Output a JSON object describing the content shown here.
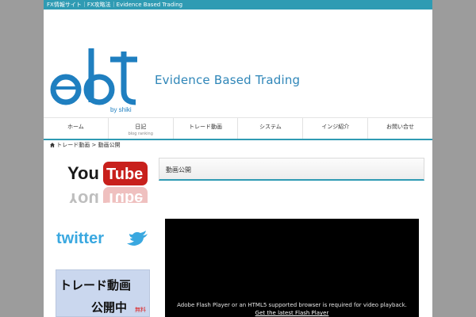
{
  "topbar": {
    "text": "FX情報サイト｜FX攻略法｜Evidence Based Trading"
  },
  "header": {
    "logo_letters": "ebt",
    "logo_byline": "by shiki",
    "brand_text": "Evidence Based Trading",
    "accent_color": "#2f9bb3",
    "brand_color": "#2f86b8"
  },
  "nav": {
    "items": [
      {
        "label": "ホーム"
      },
      {
        "label": "日記",
        "sub": "blog ranking"
      },
      {
        "label": "トレード動画"
      },
      {
        "label": "システム"
      },
      {
        "label": "インジ紹介"
      },
      {
        "label": "お問い合せ"
      }
    ]
  },
  "breadcrumb": {
    "home_icon": "home-icon",
    "home": "トレード動画",
    "separator": ">",
    "current": "動画公開"
  },
  "sidebar": {
    "youtube_text": "YouTube",
    "twitter_text": "twitter",
    "trade_banner": {
      "line1": "トレード動画",
      "line2": "公開中",
      "mark": "無料"
    }
  },
  "main": {
    "post_title": "動画公開",
    "video": {
      "message": "Adobe Flash Player or an HTML5 supported browser is required for video playback.",
      "link": "Get the latest Flash Player"
    }
  }
}
